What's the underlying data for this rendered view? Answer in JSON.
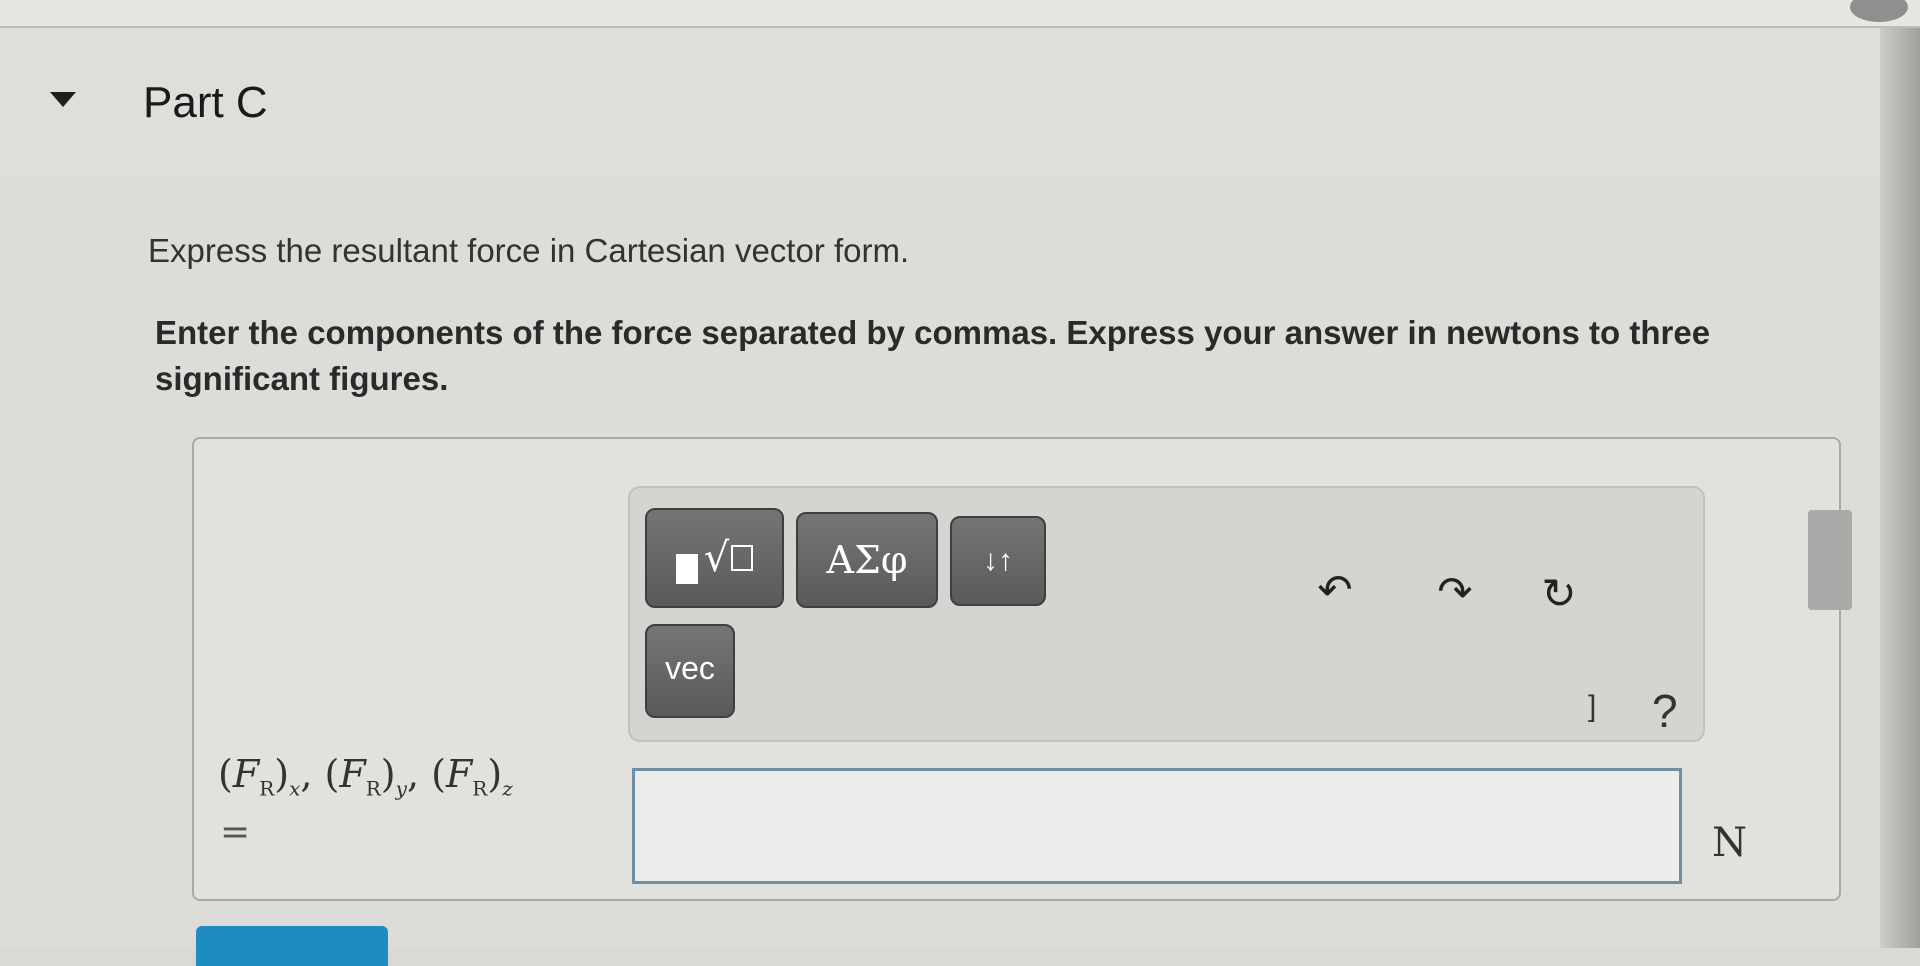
{
  "header": {
    "part_title": "Part C"
  },
  "question": {
    "prompt": "Express the resultant force in Cartesian vector form.",
    "instruction": "Enter the components of the force separated by commas. Express your answer in newtons to three significant figures."
  },
  "toolbar": {
    "greek_label": "ΑΣφ",
    "arrows_label": "↓↑",
    "vec_label": "vec",
    "undo_icon": "↶",
    "redo_icon": "↷",
    "reset_icon": "↻",
    "bracket_text": "]",
    "help_label": "?"
  },
  "answer": {
    "variable_F": "F",
    "variable_R": "R",
    "subscript_x": "x",
    "subscript_y": "y",
    "subscript_z": "z",
    "equals": "=",
    "input_value": "",
    "unit": "N"
  },
  "icons": [
    "templates-icon",
    "undo-icon",
    "redo-icon",
    "reset-icon",
    "keyboard-icon",
    "help-icon",
    "collapse-caret-icon"
  ]
}
